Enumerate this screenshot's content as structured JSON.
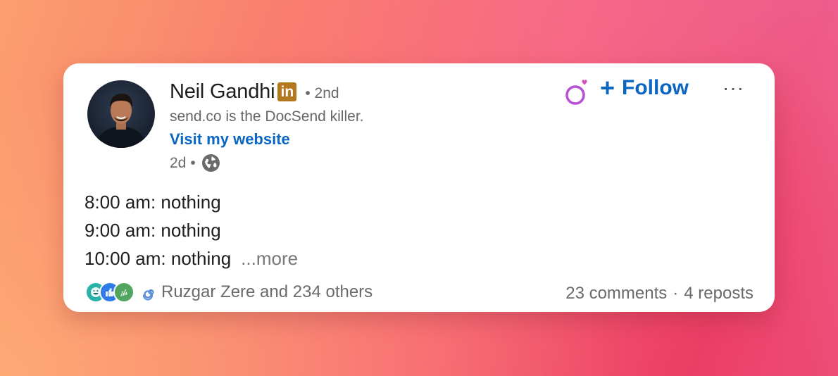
{
  "author": {
    "name": "Neil Gandhi",
    "badge": "in",
    "separator": "•",
    "degree": "2nd",
    "headline": "send.co is the DocSend killer.",
    "website_link": "Visit my website",
    "age": "2d",
    "age_separator": "•",
    "visibility_icon": "globe-icon"
  },
  "actions": {
    "follow_plus": "+",
    "follow_label": "Follow",
    "more_label": "···"
  },
  "post": {
    "lines": [
      "8:00 am: nothing",
      "9:00 am: nothing",
      "10:00 am: nothing"
    ],
    "see_more": "...more"
  },
  "social": {
    "reaction_icons": [
      "laugh-reaction-icon",
      "like-reaction-icon",
      "celebrate-reaction-icon"
    ],
    "reactors_text": "Ruzgar Zere and 234 others",
    "comments": "23 comments",
    "stats_separator": "·",
    "reposts": "4 reposts"
  },
  "colors": {
    "accent": "#0a66c2",
    "badge": "#b3781e",
    "muted_text": "#6a6a6a",
    "gender_icon": "#b74fd6"
  }
}
